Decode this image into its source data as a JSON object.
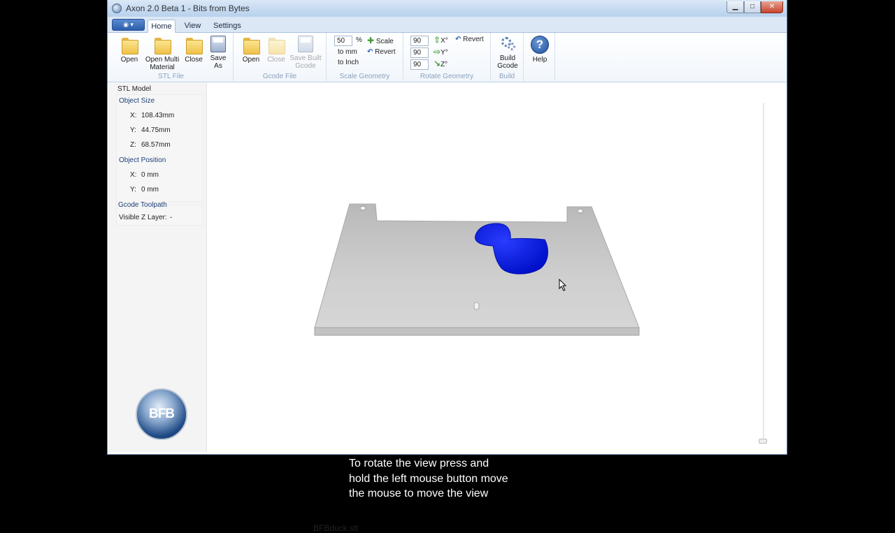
{
  "window": {
    "title": "Axon 2.0 Beta 1 - Bits from Bytes"
  },
  "ribbon_tabs": [
    "Home",
    "View",
    "Settings"
  ],
  "stl_file": {
    "label": "STL File",
    "open": "Open",
    "open_multi": [
      "Open Multi",
      "Material"
    ],
    "close": "Close",
    "save_as": [
      "Save",
      "As"
    ]
  },
  "gcode_file": {
    "label": "Gcode File",
    "open": "Open",
    "close": "Close",
    "save_built": [
      "Save Built",
      "Gcode"
    ]
  },
  "scale_geometry": {
    "label": "Scale Geometry",
    "percent_value": "50",
    "percent_symbol": "%",
    "to_mm": "to mm",
    "to_inch": "to Inch",
    "scale": "Scale",
    "revert": "Revert"
  },
  "rotate_geometry": {
    "label": "Rotate Geometry",
    "x_value": "90",
    "y_value": "90",
    "z_value": "90",
    "x_label": "X°",
    "y_label": "Y°",
    "z_label": "Z°",
    "revert": "Revert"
  },
  "build": {
    "label": "Build",
    "button": [
      "Build",
      "Gcode"
    ]
  },
  "help": {
    "label": "Help"
  },
  "sidebar": {
    "stl_model": "STL Model",
    "object_size": "Object Size",
    "size_x_label": "X:",
    "size_x": "108.43mm",
    "size_y_label": "Y:",
    "size_y": "44.75mm",
    "size_z_label": "Z:",
    "size_z": "68.57mm",
    "object_position": "Object Position",
    "pos_x_label": "X:",
    "pos_x": "0 mm",
    "pos_y_label": "Y:",
    "pos_y": "0 mm",
    "gcode_toolpath": "Gcode Toolpath",
    "visible_z_layer": "Visible Z Layer:",
    "visible_z_value": "-"
  },
  "logo": "BFB",
  "viewport": {
    "filename": "BFBduck.stl"
  },
  "caption": [
    "To rotate the view press and",
    "hold the left mouse button move",
    "the mouse to move the view"
  ],
  "colors": {
    "model": "#0a1fe0",
    "bed": "#c8c8c8",
    "accent": "#1d3f7a"
  }
}
